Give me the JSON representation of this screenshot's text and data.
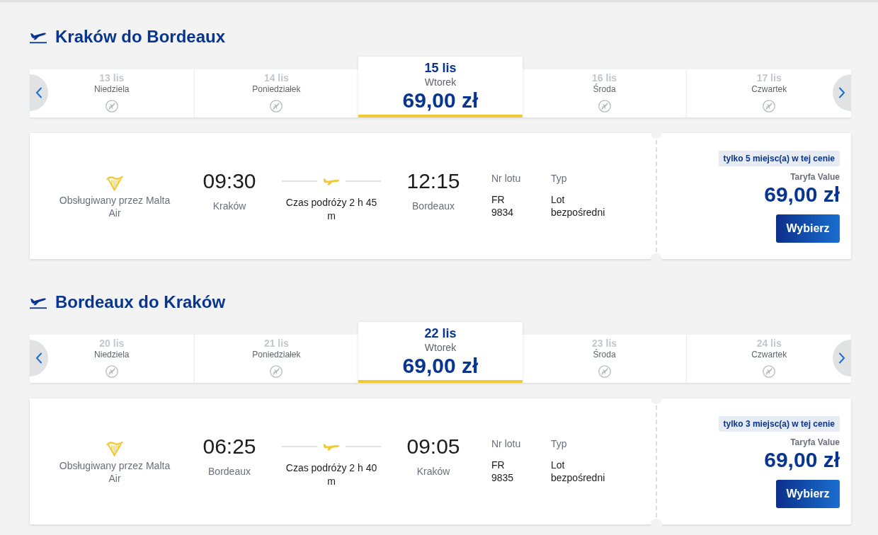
{
  "sections": [
    {
      "title": "Kraków do Bordeaux",
      "dates": [
        {
          "date": "13 lis",
          "day": "Niedziela",
          "selected": false
        },
        {
          "date": "14 lis",
          "day": "Poniedziałek",
          "selected": false
        },
        {
          "date": "15 lis",
          "day": "Wtorek",
          "price": "69,00 zł",
          "selected": true
        },
        {
          "date": "16 lis",
          "day": "Środa",
          "selected": false
        },
        {
          "date": "17 lis",
          "day": "Czwartek",
          "selected": false
        }
      ],
      "flight": {
        "operator": "Obsługiwany przez Malta Air",
        "departure_time": "09:30",
        "departure_city": "Kraków",
        "duration": "Czas podróży 2 h 45 m",
        "arrival_time": "12:15",
        "arrival_city": "Bordeaux",
        "flight_number_label": "Nr lotu",
        "flight_number": "FR 9834",
        "type_label": "Typ",
        "type": "Lot bezpośredni",
        "seats_badge": "tylko 5 miejsc(a) w tej cenie",
        "fare_name": "Taryfa Value",
        "price": "69,00 zł",
        "button": "Wybierz"
      }
    },
    {
      "title": "Bordeaux do Kraków",
      "dates": [
        {
          "date": "20 lis",
          "day": "Niedziela",
          "selected": false
        },
        {
          "date": "21 lis",
          "day": "Poniedziałek",
          "selected": false
        },
        {
          "date": "22 lis",
          "day": "Wtorek",
          "price": "69,00 zł",
          "selected": true
        },
        {
          "date": "23 lis",
          "day": "Środa",
          "selected": false
        },
        {
          "date": "24 lis",
          "day": "Czwartek",
          "selected": false
        }
      ],
      "flight": {
        "operator": "Obsługiwany przez Malta Air",
        "departure_time": "06:25",
        "departure_city": "Bordeaux",
        "duration": "Czas podróży 2 h 40 m",
        "arrival_time": "09:05",
        "arrival_city": "Kraków",
        "flight_number_label": "Nr lotu",
        "flight_number": "FR 9835",
        "type_label": "Typ",
        "type": "Lot bezpośredni",
        "seats_badge": "tylko 3 miejsc(a) w tej cenie",
        "fare_name": "Taryfa Value",
        "price": "69,00 zł",
        "button": "Wybierz"
      }
    }
  ]
}
